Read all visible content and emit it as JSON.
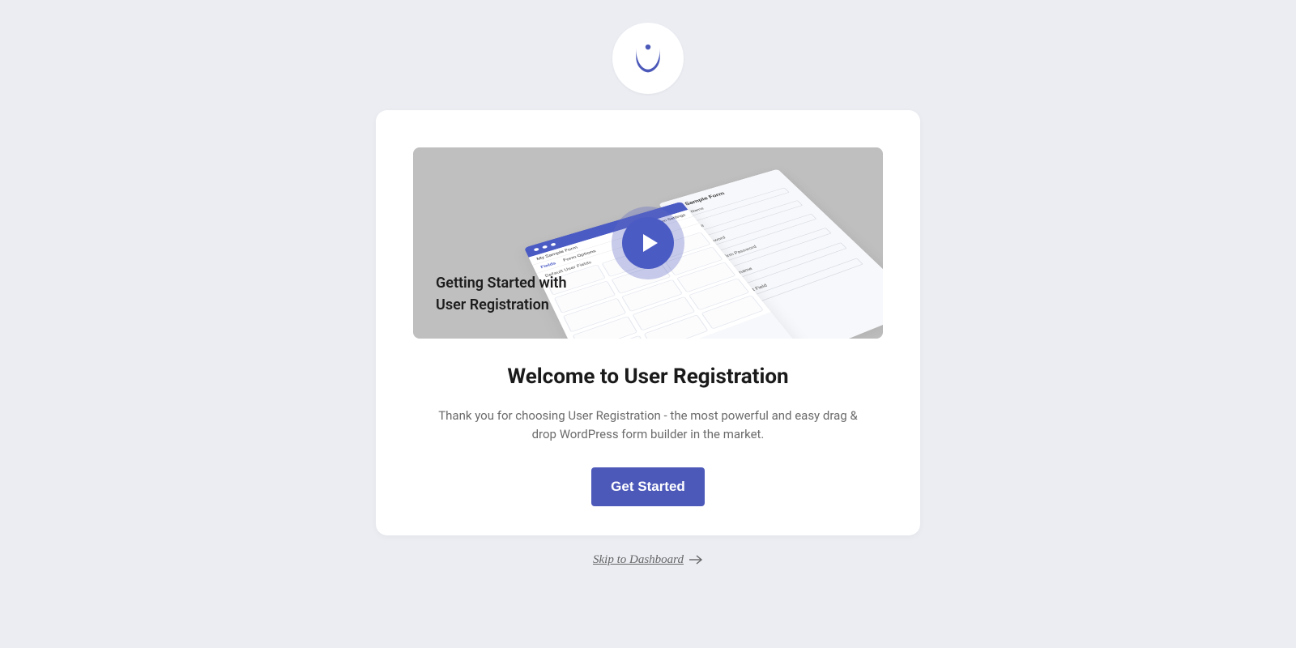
{
  "logo": {
    "name": "user-registration-logo"
  },
  "video": {
    "title": "Getting Started with\nUser Registration",
    "mock": {
      "formTitle": "My Sample Form",
      "formSettings": "Form Settings",
      "tabs": [
        "Fields",
        "Form Options"
      ],
      "section": "Default User Fields",
      "preview": {
        "title": "My Sample Form",
        "fields": [
          "First Name",
          "Email",
          "Password",
          "Confirm Password",
          "Username",
          "Input Field"
        ]
      }
    }
  },
  "heading": "Welcome to User Registration",
  "subtext": "Thank you for choosing User Registration - the most powerful and easy drag & drop WordPress form builder in the market.",
  "cta": "Get Started",
  "skip": "Skip to Dashboard",
  "colors": {
    "accent": "#4c59b9",
    "bg": "#ebedf3"
  }
}
